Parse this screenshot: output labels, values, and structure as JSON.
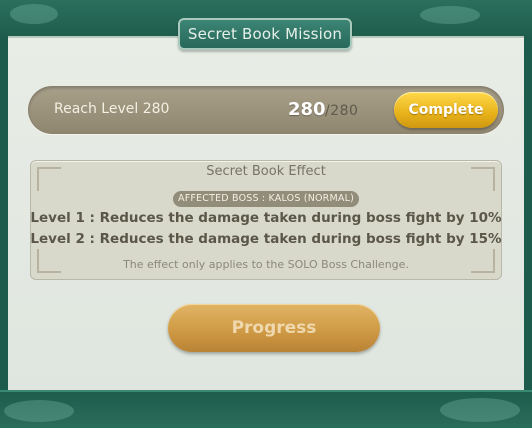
{
  "dialog": {
    "title": "Secret Book Mission"
  },
  "mission": {
    "label": "Reach Level 280",
    "current": "280",
    "max": "/280",
    "complete_label": "Complete"
  },
  "effect": {
    "title": "Secret Book Effect",
    "affected_boss": "AFFECTED BOSS :  KALOS (NORMAL)",
    "levels": [
      "Level 1 : Reduces the damage taken during boss fight by 10%",
      "Level 2 : Reduces the damage taken during boss fight by 15%"
    ],
    "note": "The effect only applies to the SOLO Boss Challenge."
  },
  "footer": {
    "progress_label": "Progress"
  },
  "colors": {
    "frame": "#1d5b4c",
    "panel": "#e4eae3",
    "complete_button": "#f0c22e",
    "progress_button": "#cf9a45"
  }
}
